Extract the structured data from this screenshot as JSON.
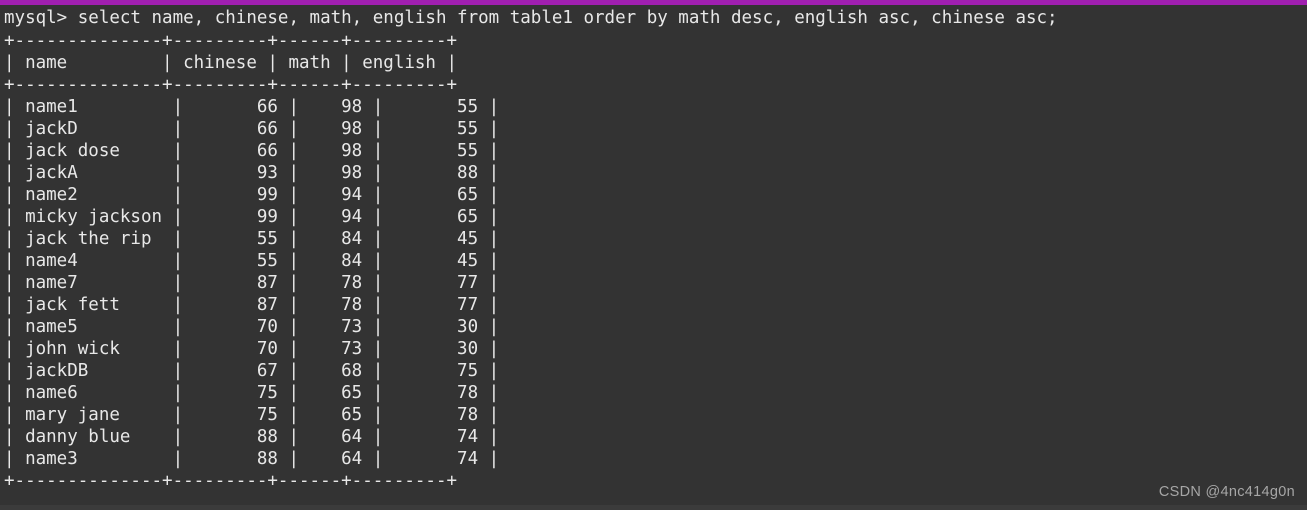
{
  "window": {
    "title": "mysql terminal",
    "background_color": "#333333",
    "text_color": "#e8e8e8",
    "accent_color": "#a01fb0",
    "bottom_bar_color": "#3b3b3b"
  },
  "prompt": {
    "prefix": "mysql>",
    "query": "select name, chinese, math, english from table1 order by math desc, english asc, chinese asc;",
    "full_line": "mysql> select name, chinese, math, english from table1 order by math desc, english asc, chinese asc;"
  },
  "result_table": {
    "border_line": "+--------------+---------+------+---------+",
    "header_line": "| name         | chinese | math | english |",
    "columns": [
      {
        "name": "name",
        "width": 14,
        "align": "left"
      },
      {
        "name": "chinese",
        "width": 9,
        "align": "right"
      },
      {
        "name": "math",
        "width": 6,
        "align": "right"
      },
      {
        "name": "english",
        "width": 9,
        "align": "right"
      }
    ],
    "rows": [
      {
        "name": "name1",
        "chinese": 66,
        "math": 98,
        "english": 55
      },
      {
        "name": "jackD",
        "chinese": 66,
        "math": 98,
        "english": 55
      },
      {
        "name": "jack dose",
        "chinese": 66,
        "math": 98,
        "english": 55
      },
      {
        "name": "jackA",
        "chinese": 93,
        "math": 98,
        "english": 88
      },
      {
        "name": "name2",
        "chinese": 99,
        "math": 94,
        "english": 65
      },
      {
        "name": "micky jackson",
        "chinese": 99,
        "math": 94,
        "english": 65
      },
      {
        "name": "jack the rip",
        "chinese": 55,
        "math": 84,
        "english": 45
      },
      {
        "name": "name4",
        "chinese": 55,
        "math": 84,
        "english": 45
      },
      {
        "name": "name7",
        "chinese": 87,
        "math": 78,
        "english": 77
      },
      {
        "name": "jack fett",
        "chinese": 87,
        "math": 78,
        "english": 77
      },
      {
        "name": "name5",
        "chinese": 70,
        "math": 73,
        "english": 30
      },
      {
        "name": "john wick",
        "chinese": 70,
        "math": 73,
        "english": 30
      },
      {
        "name": "jackDB",
        "chinese": 67,
        "math": 68,
        "english": 75
      },
      {
        "name": "name6",
        "chinese": 75,
        "math": 65,
        "english": 78
      },
      {
        "name": "mary jane",
        "chinese": 75,
        "math": 65,
        "english": 78
      },
      {
        "name": "danny blue",
        "chinese": 88,
        "math": 64,
        "english": 74
      },
      {
        "name": "name3",
        "chinese": 88,
        "math": 64,
        "english": 74
      }
    ],
    "row_count": 17
  },
  "watermark": {
    "text": "CSDN @4nc414g0n"
  }
}
